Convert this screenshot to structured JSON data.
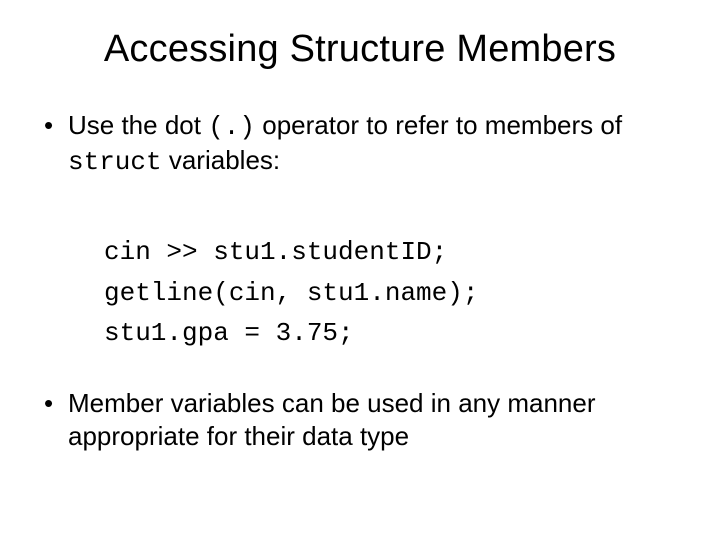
{
  "title": "Accessing Structure Members",
  "bullet1": {
    "pre": "Use the dot ",
    "op": "(.)",
    "post": " operator to refer to members of ",
    "kw": "struct",
    "tail": " variables:"
  },
  "code": {
    "l1": "cin >> stu1.studentID;",
    "l2": "getline(cin, stu1.name);",
    "l3": "stu1.gpa = 3.75;"
  },
  "bullet2": "Member variables can be used in any manner appropriate for their data type"
}
